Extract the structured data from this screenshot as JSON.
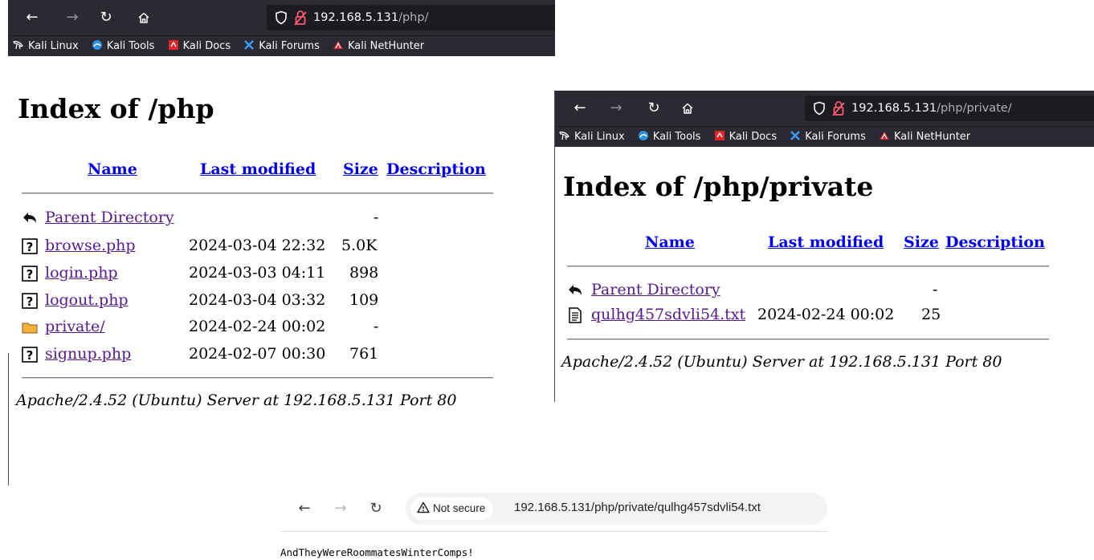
{
  "window1": {
    "url_host": "192.168.5.131",
    "url_path": "/php/",
    "bookmarks": [
      "Kali Linux",
      "Kali Tools",
      "Kali Docs",
      "Kali Forums",
      "Kali NetHunter"
    ],
    "title": "Index of /php",
    "columns": {
      "name": "Name",
      "last_modified": "Last modified",
      "size": "Size",
      "description": "Description"
    },
    "rows": [
      {
        "icon": "back-icon",
        "name": "Parent Directory",
        "date": "",
        "size": "-"
      },
      {
        "icon": "unknown-file-icon",
        "name": "browse.php",
        "date": "2024-03-04 22:32",
        "size": "5.0K"
      },
      {
        "icon": "unknown-file-icon",
        "name": "login.php",
        "date": "2024-03-03 04:11",
        "size": "898"
      },
      {
        "icon": "unknown-file-icon",
        "name": "logout.php",
        "date": "2024-03-04 03:32",
        "size": "109"
      },
      {
        "icon": "folder-icon",
        "name": "private/",
        "date": "2024-02-24 00:02",
        "size": "-"
      },
      {
        "icon": "unknown-file-icon",
        "name": "signup.php",
        "date": "2024-02-07 00:30",
        "size": "761"
      }
    ],
    "address": "Apache/2.4.52 (Ubuntu) Server at 192.168.5.131 Port 80"
  },
  "window2": {
    "url_host": "192.168.5.131",
    "url_path": "/php/private/",
    "bookmarks": [
      "Kali Linux",
      "Kali Tools",
      "Kali Docs",
      "Kali Forums",
      "Kali NetHunter"
    ],
    "title": "Index of /php/private",
    "columns": {
      "name": "Name",
      "last_modified": "Last modified",
      "size": "Size",
      "description": "Description"
    },
    "rows": [
      {
        "icon": "back-icon",
        "name": "Parent Directory",
        "date": "",
        "size": "-"
      },
      {
        "icon": "text-file-icon",
        "name": "qulhg457sdvli54.txt",
        "date": "2024-02-24 00:02",
        "size": "25"
      }
    ],
    "address": "Apache/2.4.52 (Ubuntu) Server at 192.168.5.131 Port 80"
  },
  "window3": {
    "security_label": "Not secure",
    "url": "192.168.5.131/php/private/qulhg457sdvli54.txt",
    "body_text": "AndTheyWereRoommatesWinterComps!"
  },
  "colors": {
    "ff_chrome": "#2b2a33",
    "ff_urlbar": "#1c1b22",
    "link_unvisited": "#0000ee",
    "link_visited": "#551a8b"
  }
}
